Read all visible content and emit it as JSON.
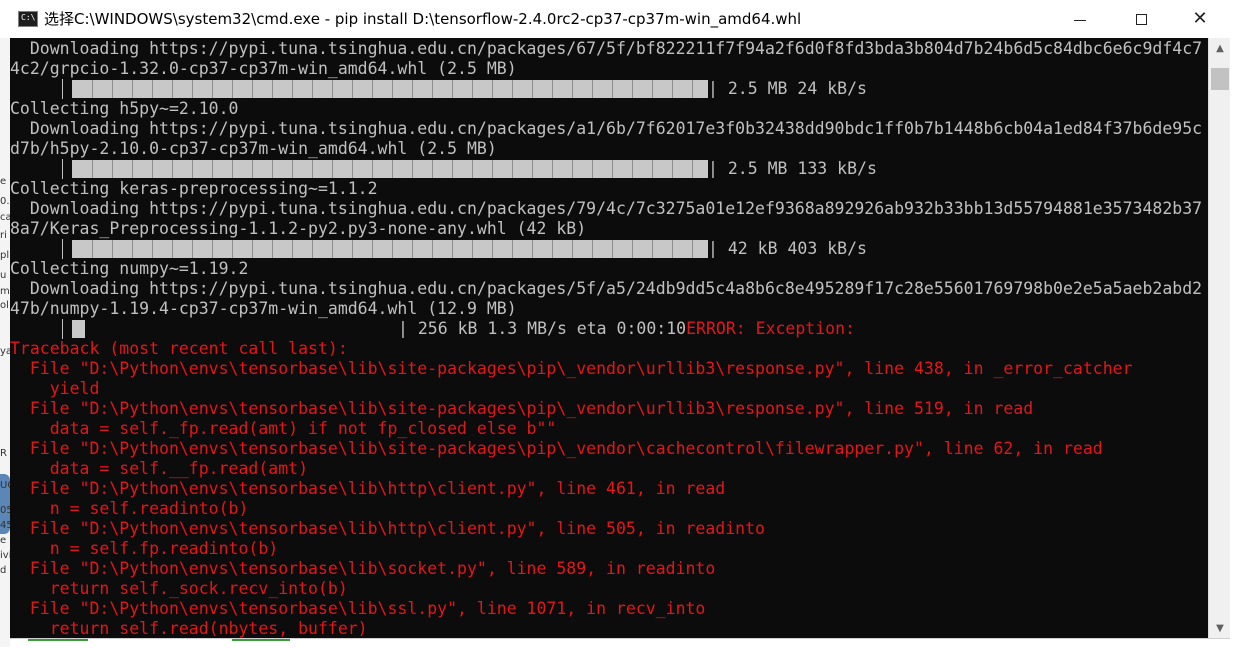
{
  "window": {
    "title": "选择C:\\WINDOWS\\system32\\cmd.exe - pip  install D:\\tensorflow-2.4.0rc2-cp37-cp37m-win_amd64.whl",
    "icon": "cmd-icon",
    "icon_text": "C:\\",
    "buttons": {
      "minimize": "minimize-icon",
      "maximize": "maximize-icon",
      "close": "close-icon"
    }
  },
  "console": {
    "lines": [
      {
        "text": "  Downloading https://pypi.tuna.tsinghua.edu.cn/packages/67/5f/bf822211f7f94a2f6d0f8fd3bda3b804d7b24b6d5c84dbc6e6c9df4c7",
        "color": "normal"
      },
      {
        "text": "4c2/grpcio-1.32.0-cp37-cp37m-win_amd64.whl (2.5 MB)",
        "color": "normal"
      },
      {
        "progress": {
          "fraction": 1.0,
          "text": "| 2.5 MB 24 kB/s"
        }
      },
      {
        "text": "Collecting h5py~=2.10.0",
        "color": "normal"
      },
      {
        "text": "  Downloading https://pypi.tuna.tsinghua.edu.cn/packages/a1/6b/7f62017e3f0b32438dd90bdc1ff0b7b1448b6cb04a1ed84f37b6de95c",
        "color": "normal"
      },
      {
        "text": "d7b/h5py-2.10.0-cp37-cp37m-win_amd64.whl (2.5 MB)",
        "color": "normal"
      },
      {
        "progress": {
          "fraction": 1.0,
          "text": "| 2.5 MB 133 kB/s"
        }
      },
      {
        "text": "Collecting keras-preprocessing~=1.1.2",
        "color": "normal"
      },
      {
        "text": "  Downloading https://pypi.tuna.tsinghua.edu.cn/packages/79/4c/7c3275a01e12ef9368a892926ab932b33bb13d55794881e3573482b37",
        "color": "normal"
      },
      {
        "text": "8a7/Keras_Preprocessing-1.1.2-py2.py3-none-any.whl (42 kB)",
        "color": "normal"
      },
      {
        "progress": {
          "fraction": 1.0,
          "text": "| 42 kB 403 kB/s"
        }
      },
      {
        "text": "Collecting numpy~=1.19.2",
        "color": "normal"
      },
      {
        "text": "  Downloading https://pypi.tuna.tsinghua.edu.cn/packages/5f/a5/24db9dd5c4a8b6c8e495289f17c28e55601769798b0e2e5a5aeb2abd2",
        "color": "normal"
      },
      {
        "text": "47b/numpy-1.19.4-cp37-cp37m-win_amd64.whl (12.9 MB)",
        "color": "normal"
      },
      {
        "progress": {
          "fraction": 0.02,
          "text": "| 256 kB 1.3 MB/s eta 0:00:10",
          "error": "ERROR: Exception:"
        }
      },
      {
        "text": "Traceback (most recent call last):",
        "color": "red"
      },
      {
        "text": "  File \"D:\\Python\\envs\\tensorbase\\lib\\site-packages\\pip\\_vendor\\urllib3\\response.py\", line 438, in _error_catcher",
        "color": "red"
      },
      {
        "text": "    yield",
        "color": "red"
      },
      {
        "text": "  File \"D:\\Python\\envs\\tensorbase\\lib\\site-packages\\pip\\_vendor\\urllib3\\response.py\", line 519, in read",
        "color": "red"
      },
      {
        "text": "    data = self._fp.read(amt) if not fp_closed else b\"\"",
        "color": "red"
      },
      {
        "text": "  File \"D:\\Python\\envs\\tensorbase\\lib\\site-packages\\pip\\_vendor\\cachecontrol\\filewrapper.py\", line 62, in read",
        "color": "red"
      },
      {
        "text": "    data = self.__fp.read(amt)",
        "color": "red"
      },
      {
        "text": "  File \"D:\\Python\\envs\\tensorbase\\lib\\http\\client.py\", line 461, in read",
        "color": "red"
      },
      {
        "text": "    n = self.readinto(b)",
        "color": "red"
      },
      {
        "text": "  File \"D:\\Python\\envs\\tensorbase\\lib\\http\\client.py\", line 505, in readinto",
        "color": "red"
      },
      {
        "text": "    n = self.fp.readinto(b)",
        "color": "red"
      },
      {
        "text": "  File \"D:\\Python\\envs\\tensorbase\\lib\\socket.py\", line 589, in readinto",
        "color": "red"
      },
      {
        "text": "    return self._sock.recv_into(b)",
        "color": "red"
      },
      {
        "text": "  File \"D:\\Python\\envs\\tensorbase\\lib\\ssl.py\", line 1071, in recv_into",
        "color": "red"
      },
      {
        "text": "    return self.read(nbytes, buffer)",
        "color": "red"
      }
    ]
  },
  "background_fragments": [
    "e",
    "0.",
    "ca",
    "ri",
    "pl",
    "u",
    "m",
    "ol",
    "ya",
    "R",
    "UC",
    "05",
    "45",
    "e",
    "ivi",
    "d"
  ],
  "colors": {
    "console_bg": "#0c0c0c",
    "text": "#c0c0c0",
    "error": "#e3161a",
    "progress_fill": "#c8c8c8"
  },
  "scrollbar": {
    "up": "scroll-up-arrow",
    "down": "scroll-down-arrow"
  }
}
